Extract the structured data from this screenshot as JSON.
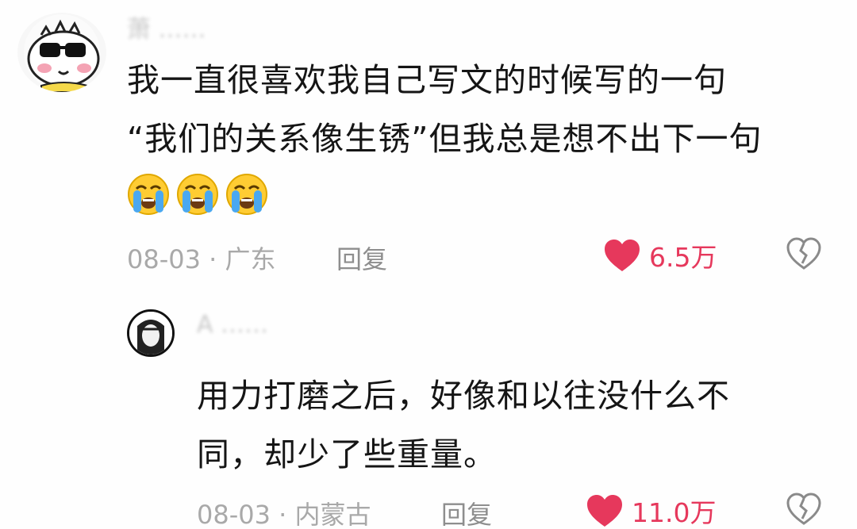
{
  "comment": {
    "username": "萧 ……",
    "text_line1": "我一直很喜欢我自己写文的时候写的一句",
    "text_line2": "“我们的关系像生锈”但我总是想不出下一句",
    "emojis": [
      "loudly-crying-face",
      "loudly-crying-face",
      "loudly-crying-face"
    ],
    "date_location": "08-03 · 广东",
    "reply_label": "回复",
    "like_count": "6.5万"
  },
  "reply": {
    "username": "A ……",
    "text_line1": "用力打磨之后，好像和以往没什么不",
    "text_line2": "同，却少了些重量。",
    "date_location": "08-03 · 内蒙古",
    "reply_label": "回复",
    "like_count": "11.0万"
  },
  "colors": {
    "like_red": "#e6385c",
    "meta_gray": "#a9a9a9",
    "text_dark": "#151515"
  }
}
